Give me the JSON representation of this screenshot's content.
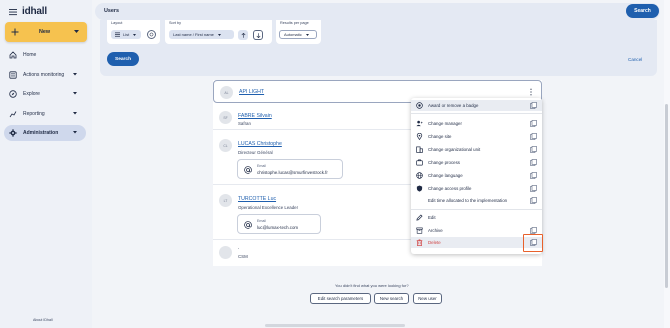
{
  "app": {
    "logo": "idhall",
    "new_label": "New",
    "about": "About IDhall"
  },
  "sidebar": {
    "items": [
      {
        "label": "Home"
      },
      {
        "label": "Actions monitoring"
      },
      {
        "label": "Explore"
      },
      {
        "label": "Reporting"
      },
      {
        "label": "Administration"
      }
    ]
  },
  "topbar": {
    "title": "Users",
    "search_label": "Search"
  },
  "filters": {
    "layout_label": "Layout",
    "layout_value": "List",
    "sort_label": "Sort by",
    "sort_value": "Last name / First name",
    "results_label": "Results per page",
    "results_value": "Automatic",
    "search_label": "Search",
    "cancel_label": "Cancel"
  },
  "results": [
    {
      "initials": "AL",
      "name": "API LIGHT",
      "subtitle": "",
      "email_label": "",
      "email": ""
    },
    {
      "initials": "SF",
      "name": "FABRE Silvain",
      "subtitle": "Safran",
      "email_label": "",
      "email": ""
    },
    {
      "initials": "CL",
      "name": "LUCAS Christophe",
      "subtitle": "Directeur Général",
      "email_label": "Email",
      "email": "christophe.lucas@smurfinvestrock.fr"
    },
    {
      "initials": "LT",
      "name": "TURCOTTE Luc",
      "subtitle": "Operational Excellence Leader",
      "email_label": "Email",
      "email": "luc@lumax-tech.com"
    },
    {
      "initials": "",
      "name": ".",
      "subtitle": "CSM",
      "email_label": "",
      "email": ""
    }
  ],
  "footer": {
    "not_found": "You didn't find what you were looking for?",
    "edit_params": "Edit search parameters",
    "new_search": "New search",
    "new_user": "New user"
  },
  "context_menu": {
    "items": [
      {
        "label": "Award or remove a badge",
        "icon": "badge-icon"
      },
      {
        "label": "Change manager",
        "icon": "manager-icon"
      },
      {
        "label": "Change site",
        "icon": "location-icon"
      },
      {
        "label": "Change organizational unit",
        "icon": "org-unit-icon"
      },
      {
        "label": "Change process",
        "icon": "process-icon"
      },
      {
        "label": "Change language",
        "icon": "globe-icon"
      },
      {
        "label": "Change access profile",
        "icon": "shield-icon"
      },
      {
        "label": "Edit time allocated to the implementation",
        "icon": ""
      },
      {
        "label": "Edit",
        "icon": "pencil-icon"
      },
      {
        "label": "Archive",
        "icon": "archive-icon"
      },
      {
        "label": "Delete",
        "icon": "trash-icon"
      }
    ]
  },
  "colors": {
    "accent": "#1f5fae",
    "new_button": "#f6c24f",
    "danger": "#d14343",
    "highlight": "#e8612c"
  }
}
